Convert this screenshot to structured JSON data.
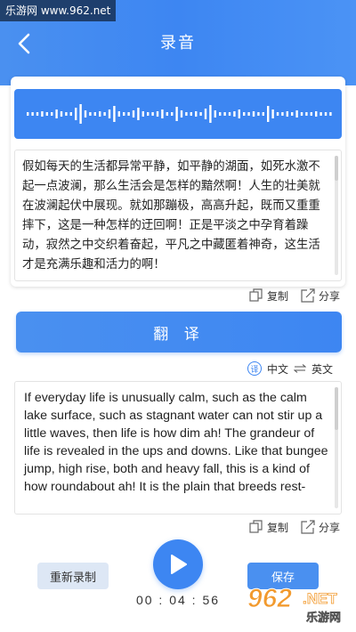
{
  "watermark_top": "乐游网 www.962.net",
  "header": {
    "title": "录音"
  },
  "transcript": {
    "text": "假如每天的生活都异常平静，如平静的湖面，如死水激不起一点波澜，那么生活会是怎样的黯然啊！人生的壮美就在波澜起伏中展现。就如那蹦极，高高升起，既而又重重摔下，这是一种怎样的迂回啊！正是平淡之中孕育着躁动，寂然之中交织着奋起，平凡之中藏匿着神奇，这生活才是充满乐趣和活力的啊！"
  },
  "actions": {
    "copy": "复制",
    "share": "分享"
  },
  "translate_button": "翻 译",
  "language": {
    "icon_glyph": "译",
    "from": "中文",
    "to": "英文"
  },
  "translation": {
    "text": "If everyday life is unusually calm, such as the calm lake surface, such as stagnant water can not stir up a little waves, then life is how dim ah! The grandeur of life is revealed in the ups and downs. Like that bungee jump, high rise, both and heavy fall, this is a kind of how roundabout ah! It is the plain that breeds rest-"
  },
  "footer": {
    "rerecord": "重新录制",
    "save": "保存",
    "timer": "00 : 04 : 56"
  },
  "logo_watermark": {
    "brand": "962",
    "tld": ".NET",
    "sub": "乐游网"
  },
  "colors": {
    "primary": "#3d86f2",
    "text": "#222222"
  }
}
